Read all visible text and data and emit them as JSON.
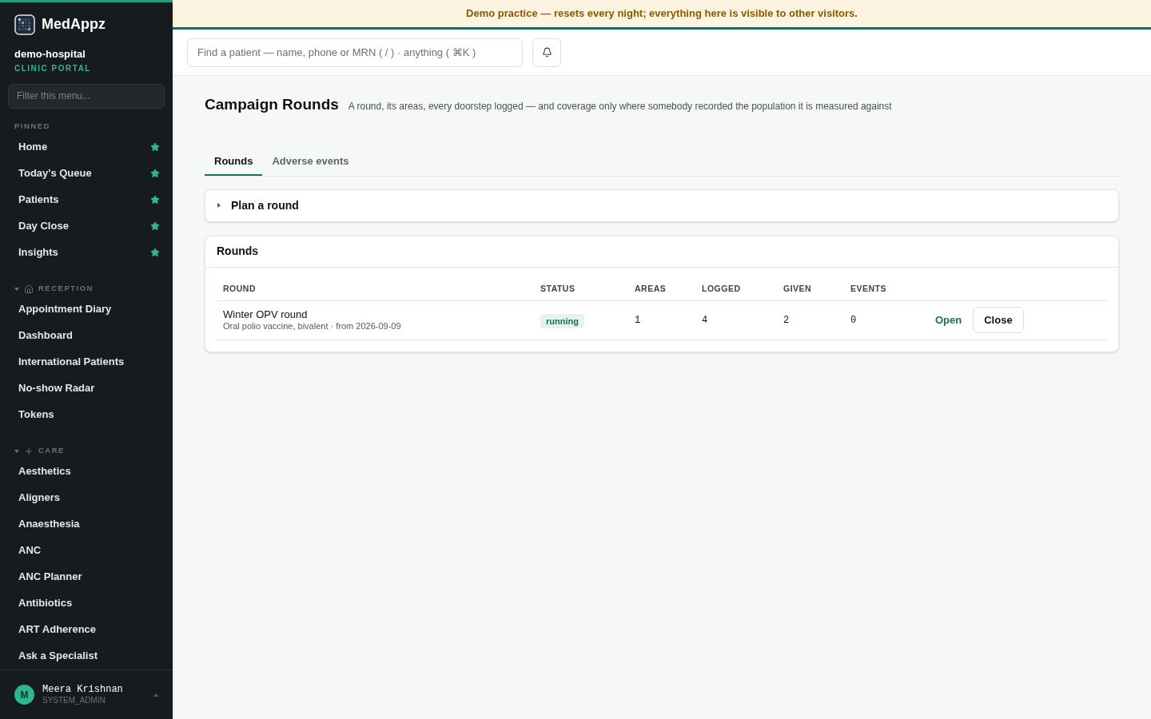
{
  "brand": {
    "name": "MedAppz",
    "org": "demo-hospital",
    "portal": "CLINIC PORTAL"
  },
  "sidebar": {
    "filter_placeholder": "Filter this menu...",
    "sections": [
      {
        "kind": "pinned",
        "title": "PINNED",
        "items": [
          {
            "label": "Home",
            "pinned": true
          },
          {
            "label": "Today's Queue",
            "pinned": true
          },
          {
            "label": "Patients",
            "pinned": true
          },
          {
            "label": "Day Close",
            "pinned": true
          },
          {
            "label": "Insights",
            "pinned": true
          }
        ]
      },
      {
        "kind": "reception",
        "title": "RECEPTION",
        "expanded": true,
        "items": [
          {
            "label": "Appointment Diary",
            "pinned": false
          },
          {
            "label": "Dashboard",
            "pinned": false
          },
          {
            "label": "International Patients",
            "pinned": false
          },
          {
            "label": "No-show Radar",
            "pinned": false
          },
          {
            "label": "Tokens",
            "pinned": false
          }
        ]
      },
      {
        "kind": "care",
        "title": "CARE",
        "expanded": true,
        "items": [
          {
            "label": "Aesthetics",
            "pinned": false
          },
          {
            "label": "Aligners",
            "pinned": false
          },
          {
            "label": "Anaesthesia",
            "pinned": false
          },
          {
            "label": "ANC",
            "pinned": false
          },
          {
            "label": "ANC Planner",
            "pinned": false
          },
          {
            "label": "Antibiotics",
            "pinned": false
          },
          {
            "label": "ART Adherence",
            "pinned": false
          },
          {
            "label": "Ask a Specialist",
            "pinned": false
          }
        ]
      }
    ]
  },
  "user": {
    "initial": "M",
    "name": "Meera Krishnan",
    "role": "SYSTEM_ADMIN"
  },
  "banner": "Demo practice — resets every night; everything here is visible to other visitors.",
  "search": {
    "placeholder": "Find a patient — name, phone or MRN ( / ) · anything ( ⌘K )"
  },
  "page": {
    "title": "Campaign Rounds",
    "subtitle": "A round, its areas, every doorstep logged — and coverage only where somebody recorded the population it is measured against"
  },
  "tabs": [
    {
      "label": "Rounds",
      "selected": true
    },
    {
      "label": "Adverse events",
      "selected": false
    }
  ],
  "plan": {
    "title": "Plan a round",
    "expanded": false
  },
  "rounds": {
    "title": "Rounds",
    "columns": [
      "ROUND",
      "STATUS",
      "AREAS",
      "LOGGED",
      "GIVEN",
      "EVENTS"
    ],
    "rows": [
      {
        "name": "Winter OPV round",
        "detail": "Oral polio vaccine, bivalent · from 2026-09-09",
        "status": "running",
        "areas": "1",
        "logged": "4",
        "given": "2",
        "events": "0",
        "actions": [
          "Open",
          "Close"
        ]
      }
    ]
  }
}
